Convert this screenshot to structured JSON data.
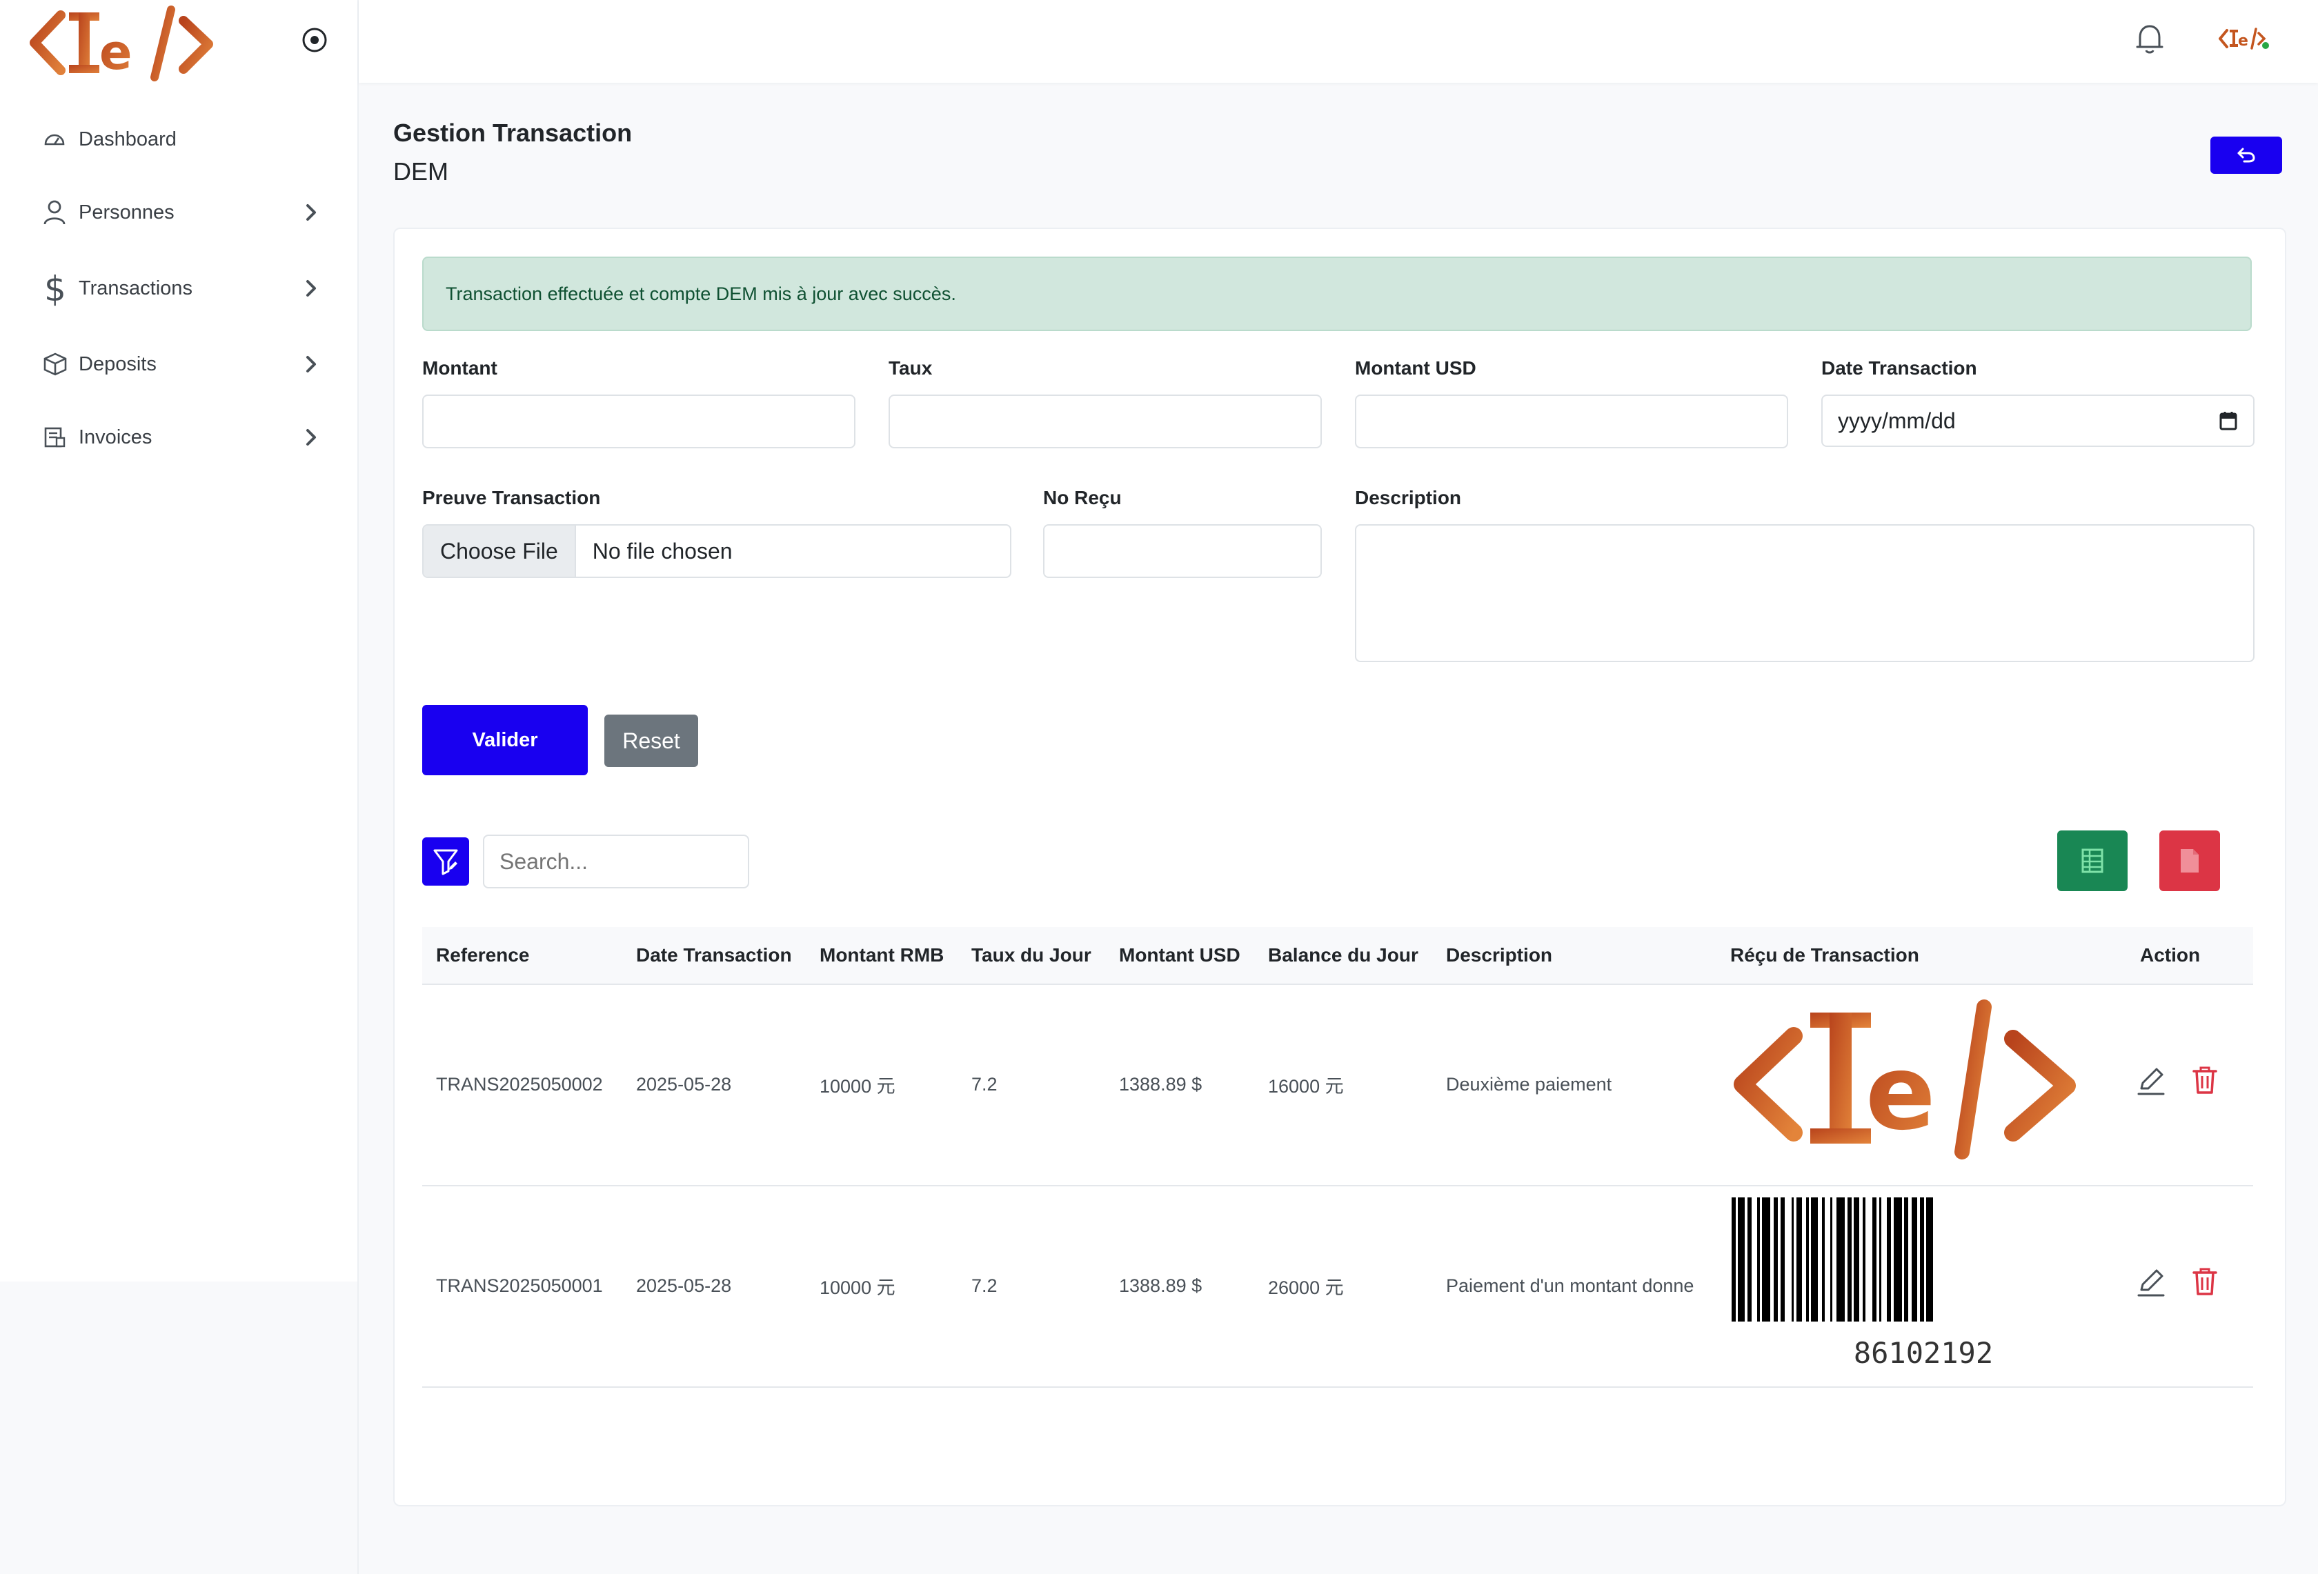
{
  "app": {
    "brand_color": "#c4561f",
    "primary_color": "#1900f0",
    "logo_icon": "te-code-logo"
  },
  "sidebar": {
    "items": [
      {
        "label": "Dashboard",
        "icon": "dashboard-gauge-icon",
        "has_submenu": false
      },
      {
        "label": "Personnes",
        "icon": "user-icon",
        "has_submenu": true
      },
      {
        "label": "Transactions",
        "icon": "dollar-icon",
        "has_submenu": true
      },
      {
        "label": "Deposits",
        "icon": "box-icon",
        "has_submenu": true
      },
      {
        "label": "Invoices",
        "icon": "invoice-icon",
        "has_submenu": true
      }
    ]
  },
  "header": {
    "title": "Gestion Transaction",
    "subtitle": "DEM"
  },
  "alert": {
    "message": "Transaction effectuée et compte DEM mis à jour avec succès.",
    "color": "#d1e7dd"
  },
  "form": {
    "montant_label": "Montant",
    "taux_label": "Taux",
    "montant_usd_label": "Montant USD",
    "date_label": "Date Transaction",
    "date_placeholder": "yyyy/mm/dd",
    "preuve_label": "Preuve Transaction",
    "file_button": "Choose File",
    "file_status": "No file chosen",
    "no_recu_label": "No Reçu",
    "description_label": "Description",
    "submit_label": "Valider",
    "reset_label": "Reset"
  },
  "table_tools": {
    "search_placeholder": "Search..."
  },
  "table": {
    "columns": [
      "Reference",
      "Date Transaction",
      "Montant RMB",
      "Taux du Jour",
      "Montant USD",
      "Balance du Jour",
      "Description",
      "Réçu de Transaction",
      "Action"
    ],
    "rows": [
      {
        "reference": "TRANS2025050002",
        "date": "2025-05-28",
        "montant_rmb": "10000 元",
        "taux": "7.2",
        "montant_usd": "1388.89 $",
        "balance": "16000 元",
        "description": "Deuxième paiement",
        "receipt": "logo-image"
      },
      {
        "reference": "TRANS2025050001",
        "date": "2025-05-28",
        "montant_rmb": "10000 元",
        "taux": "7.2",
        "montant_usd": "1388.89 $",
        "balance": "26000 元",
        "description": "Paiement d'un montant donne",
        "receipt": "barcode-image",
        "barcode_number": "86102192"
      }
    ]
  }
}
